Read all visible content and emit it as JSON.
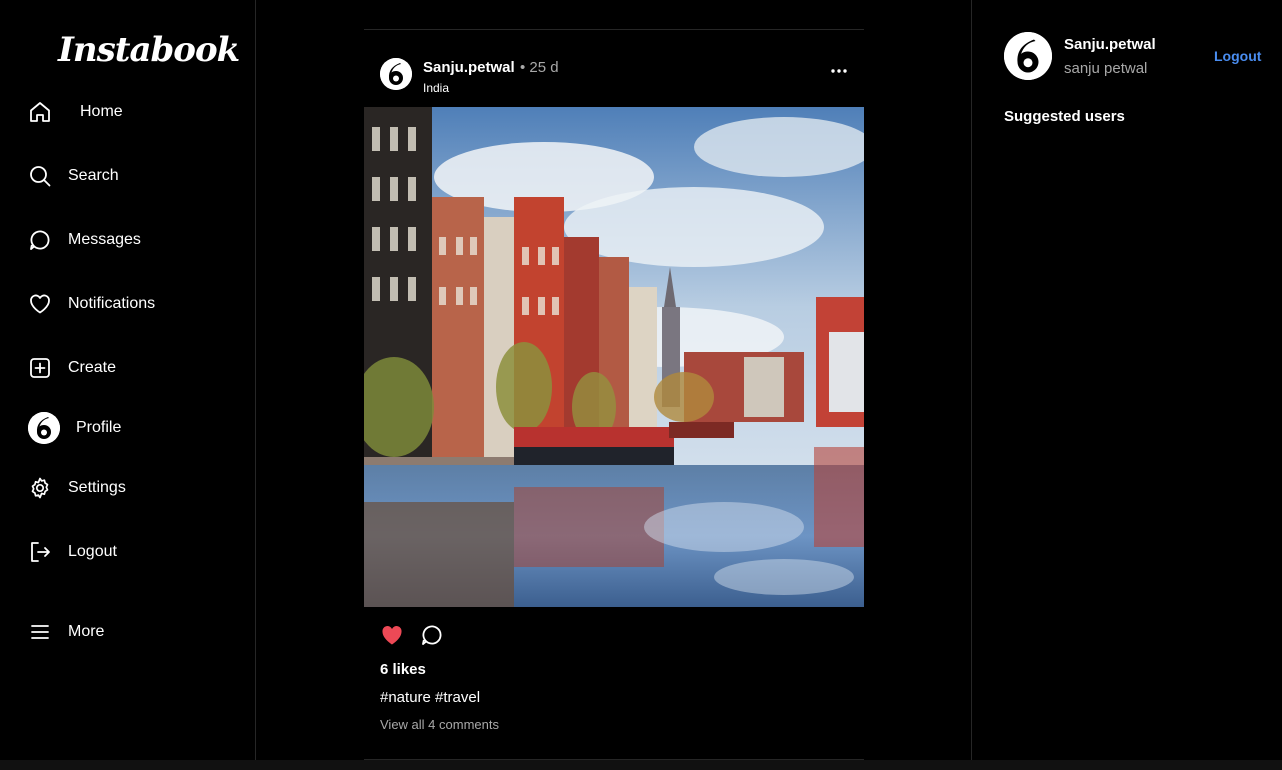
{
  "app": {
    "logo": "Instabook"
  },
  "sidebar": {
    "items": [
      {
        "label": "Home",
        "icon": "home-icon"
      },
      {
        "label": "Search",
        "icon": "search-icon"
      },
      {
        "label": "Messages",
        "icon": "message-icon"
      },
      {
        "label": "Notifications",
        "icon": "heart-icon"
      },
      {
        "label": "Create",
        "icon": "plus-square-icon"
      },
      {
        "label": "Profile",
        "icon": "avatar"
      },
      {
        "label": "Settings",
        "icon": "gear-icon"
      },
      {
        "label": "Logout",
        "icon": "logout-icon"
      },
      {
        "label": "More",
        "icon": "menu-icon"
      }
    ]
  },
  "post": {
    "username": "Sanju.petwal",
    "time": "• 25 d",
    "location": "India",
    "likes": "6 likes",
    "caption": "#nature #travel",
    "comments_link": "View all 4 comments",
    "liked": true,
    "like_color": "#ed4956"
  },
  "current_user": {
    "username": "Sanju.petwal",
    "full_name": "sanju petwal",
    "logout_label": "Logout",
    "logout_color": "#4a8df0"
  },
  "suggested": {
    "title": "Suggested users"
  }
}
